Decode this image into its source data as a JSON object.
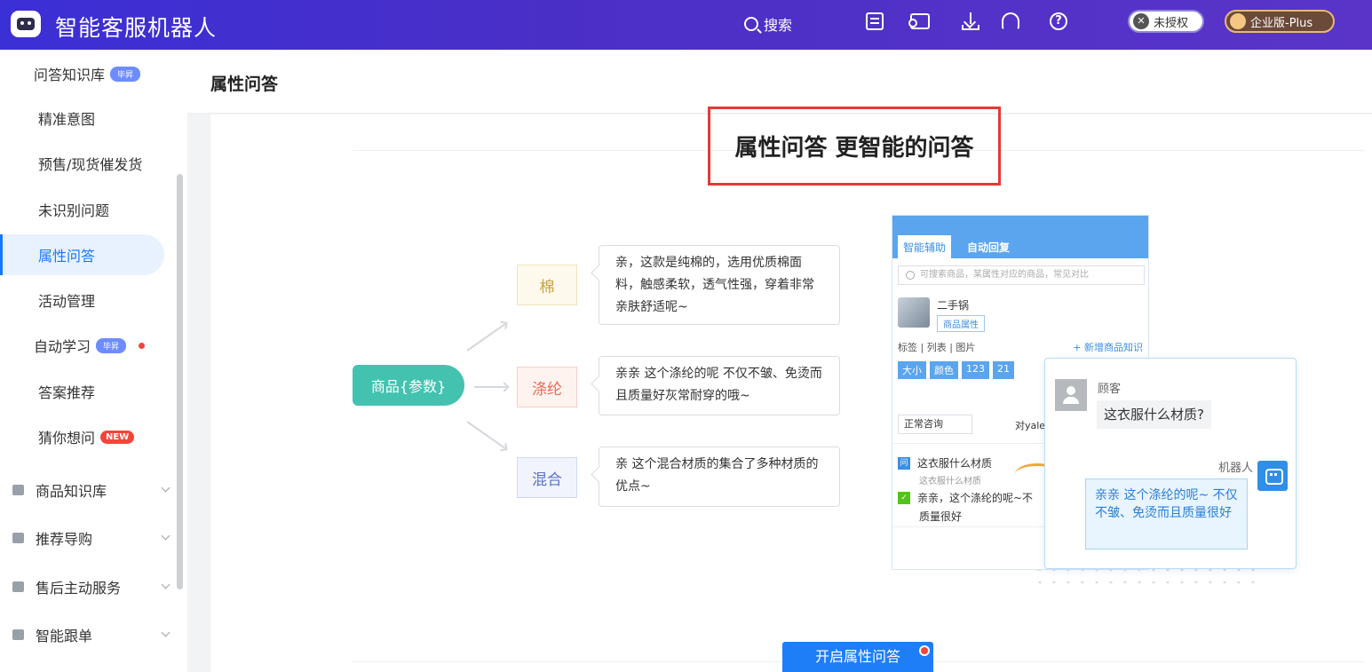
{
  "app": {
    "title": "智能客服机器人"
  },
  "topbar": {
    "search_label": "搜索",
    "icons": [
      "list-icon",
      "ticket-icon",
      "download-icon",
      "headset-icon",
      "help-icon"
    ],
    "unauth_label": "未授权",
    "edition_label": "企业版-Plus"
  },
  "sidebar": {
    "qa_kb": {
      "label": "问答知识库",
      "badge": "毕昇"
    },
    "sub_items": [
      {
        "label": "精准意图"
      },
      {
        "label": "预售/现货催发货"
      },
      {
        "label": "未识别问题"
      },
      {
        "label": "属性问答"
      },
      {
        "label": "活动管理"
      }
    ],
    "auto_learn": {
      "label": "自动学习",
      "badge": "毕昇"
    },
    "answer_rec": {
      "label": "答案推荐"
    },
    "guess": {
      "label": "猜你想问",
      "badge": "NEW"
    },
    "groups": [
      {
        "label": "商品知识库"
      },
      {
        "label": "推荐导购"
      },
      {
        "label": "售后主动服务"
      },
      {
        "label": "智能跟单"
      }
    ]
  },
  "header": {
    "title": "属性问答"
  },
  "promo": {
    "title": "属性问答 更智能的问答",
    "root_node": "商品{参数}",
    "attributes": [
      {
        "name": "棉",
        "answer": "亲，这款是纯棉的，选用优质棉面料，触感柔软，透气性强，穿着非常亲肤舒适呢~"
      },
      {
        "name": "涤纶",
        "answer": "亲亲 这个涤纶的呢 不仅不皱、免烫而且质量好灰常耐穿的哦~"
      },
      {
        "name": "混合",
        "answer": "亲 这个混合材质的集合了多种材质的优点~"
      }
    ],
    "mock": {
      "tab_assist": "智能辅助",
      "tab_auto": "自动回复",
      "search_placeholder": "可搜索商品，某属性对应的商品，常见对比",
      "product_name": "二手锅",
      "product_tag": "商品属性",
      "row_tabs": "标签 | 列表 | 图片",
      "add_link": "+ 新增商品知识",
      "chips": [
        "大小",
        "颜色",
        "123",
        "21"
      ],
      "select_value": "正常咨询",
      "select_right": "对yale",
      "q_text": "这衣服什么材质",
      "q_sub": "这衣服什么材质",
      "q_icon": "问",
      "a_text": "亲亲，这个涤纶的呢~不",
      "a_sub": "质量很好",
      "a_icon": "✓"
    },
    "chat": {
      "customer_name": "顾客",
      "customer_msg": "这衣服什么材质?",
      "bot_name": "机器人",
      "bot_msg": "亲亲 这个涤纶的呢~ 不仅不皱、免烫而且质量很好"
    },
    "cta_label": "开启属性问答"
  }
}
